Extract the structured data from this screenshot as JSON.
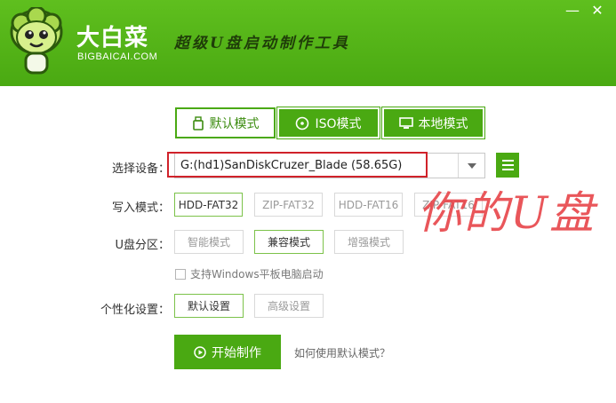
{
  "app": {
    "brand_name": "大白菜",
    "brand_domain": "BIGBAICAI.COM",
    "slogan": "超级U盘启动制作工具",
    "minimize_glyph": "—",
    "close_glyph": "✕"
  },
  "tabs": [
    {
      "label": "默认模式",
      "icon": "usb-icon",
      "active": true
    },
    {
      "label": "ISO模式",
      "icon": "disc-icon",
      "active": false
    },
    {
      "label": "本地模式",
      "icon": "monitor-icon",
      "active": false
    }
  ],
  "device": {
    "label": "选择设备：",
    "value": "G:(hd1)SanDiskCruzer_Blade (58.65G)"
  },
  "write_mode": {
    "label": "写入模式：",
    "options": [
      "HDD-FAT32",
      "ZIP-FAT32",
      "HDD-FAT16",
      "ZIP-FAT16"
    ],
    "selected": "HDD-FAT32"
  },
  "partition": {
    "label": "U盘分区：",
    "options": [
      "智能模式",
      "兼容模式",
      "增强模式"
    ],
    "selected": "兼容模式"
  },
  "windows_tablet": {
    "label": "支持Windows平板电脑启动",
    "checked": false
  },
  "personalize": {
    "label": "个性化设置：",
    "options": [
      "默认设置",
      "高级设置"
    ],
    "selected": "默认设置"
  },
  "actions": {
    "start_label": "开始制作",
    "help_link": "如何使用默认模式？"
  },
  "overlay": {
    "text": "你的U盘"
  },
  "colors": {
    "brand_green": "#4aa912",
    "highlight_red": "#d0222a",
    "overlay_red": "#e8484d"
  }
}
